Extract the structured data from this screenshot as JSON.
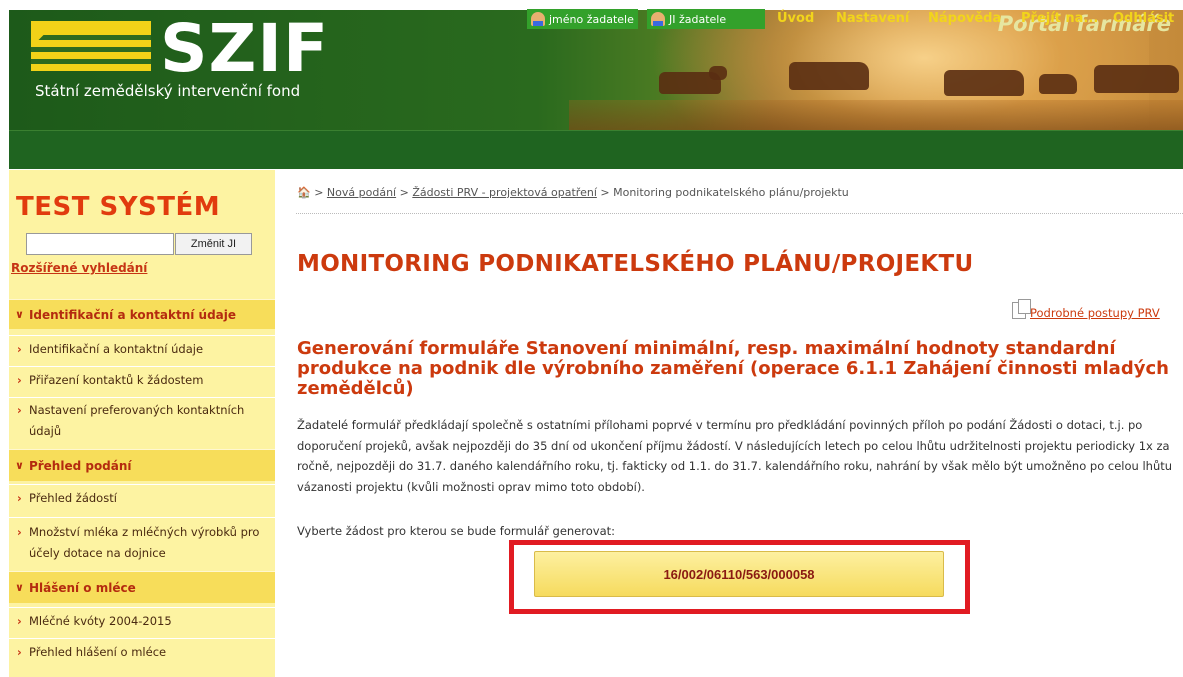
{
  "header": {
    "logo_name": "SZIF",
    "logo_subtitle": "Státní zemědělský intervenční fond",
    "portal_title": "Portál farmáře"
  },
  "topnav": {
    "user_name": "jméno žadatele",
    "user_ji": "JI žadatele",
    "items": [
      "Úvod",
      "Nastavení",
      "Nápověda",
      "Přejít na...",
      "Odhlásit"
    ]
  },
  "sidebar": {
    "title": "TEST SYSTÉM",
    "ji_input_value": "",
    "ji_button": "Změnit JI",
    "advanced_search": "Rozšířené vyhledání",
    "sections": [
      {
        "label": "Identifikační a kontaktní údaje",
        "items": [
          "Identifikační a kontaktní údaje",
          "Přiřazení kontaktů k žádostem",
          "Nastavení preferovaných kontaktních údajů"
        ]
      },
      {
        "label": "Přehled podání",
        "items": [
          "Přehled žádostí",
          "Množství mléka z mléčných výrobků pro účely dotace na dojnice"
        ]
      },
      {
        "label": "Hlášení o mléce",
        "items": [
          "Mléčné kvóty 2004-2015",
          "Přehled hlášení o mléce"
        ]
      }
    ]
  },
  "breadcrumb": {
    "home_icon": "home-icon",
    "sep": ">",
    "links": [
      "Nová podání",
      "Žádosti PRV - projektová opatření"
    ],
    "current": "Monitoring podnikatelského plánu/projektu"
  },
  "main": {
    "title": "MONITORING PODNIKATELSKÉHO PLÁNU/PROJEKTU",
    "prv_link": "Podrobné postupy PRV",
    "section_heading": "Generování formuláře Stanovení minimální, resp. maximální hodnoty standardní produkce na podnik dle výrobního zaměření (operace 6.1.1 Zahájení činnosti mladých zemědělců)",
    "body_text": "Žadatelé formulář předkládají společně s ostatními přílohami poprvé v termínu pro předkládání povinných příloh po podání Žádosti o dotaci, t.j. po doporučení projeků, avšak nejpozději do 35 dní od ukončení příjmu žádostí. V následujících letech po celou lhůtu udržitelnosti projektu periodicky 1x za ročně, nejpozději do 31.7. daného kalendářního roku, tj. fakticky od 1.1. do 31.7. kalendářního roku, nahrání by však mělo být umožněno po celou lhůtu vázanosti projektu (kvůli možnosti oprav mimo toto období).",
    "select_label": "Vyberte žádost pro kterou se bude formulář generovat:",
    "application_button": "16/002/06110/563/000058"
  },
  "colors": {
    "accent": "#cc3a0e",
    "nav_green": "#1f6420",
    "nav_link": "#f2d51a",
    "sidebar_bg": "#fdf3a2",
    "highlight": "#e11b22"
  }
}
